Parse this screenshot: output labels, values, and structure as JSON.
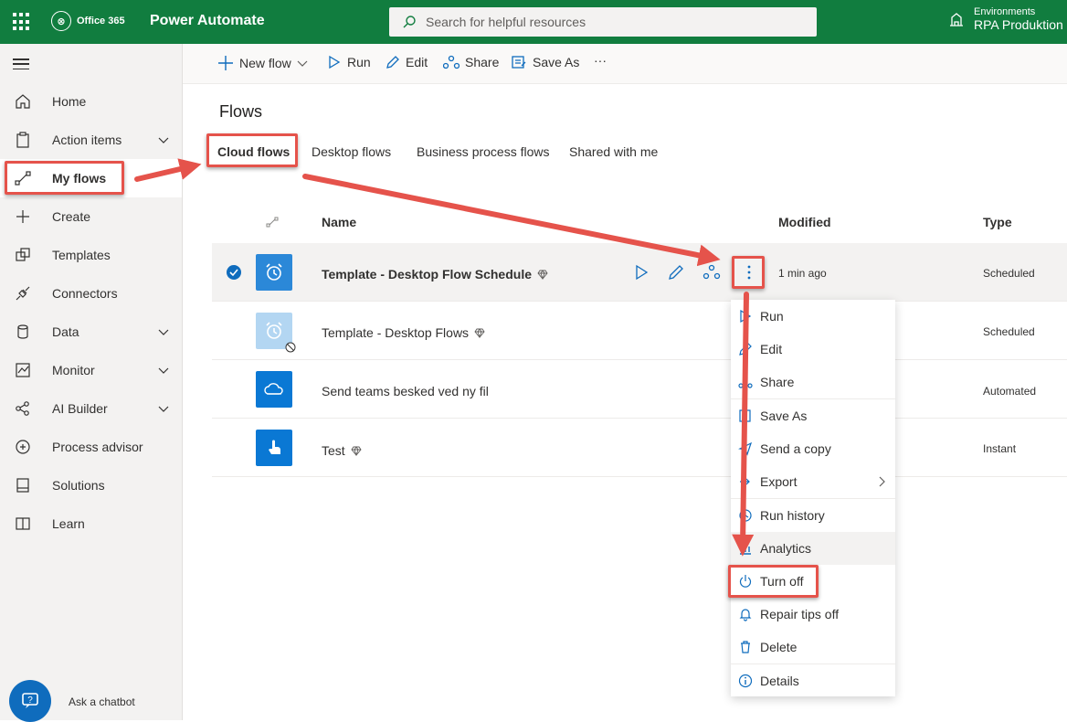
{
  "topbar": {
    "suite": "Office 365",
    "app": "Power Automate",
    "search_placeholder": "Search for helpful resources",
    "env_label": "Environments",
    "env_value": "RPA Produktion"
  },
  "sidebar": {
    "items": [
      {
        "label": "Home",
        "icon": "home-icon"
      },
      {
        "label": "Action items",
        "icon": "clipboard-icon",
        "expandable": true
      },
      {
        "label": "My flows",
        "icon": "flow-icon",
        "active": true
      },
      {
        "label": "Create",
        "icon": "plus-icon"
      },
      {
        "label": "Templates",
        "icon": "templates-icon"
      },
      {
        "label": "Connectors",
        "icon": "plug-icon"
      },
      {
        "label": "Data",
        "icon": "database-icon",
        "expandable": true
      },
      {
        "label": "Monitor",
        "icon": "monitor-icon",
        "expandable": true
      },
      {
        "label": "AI Builder",
        "icon": "ai-icon",
        "expandable": true
      },
      {
        "label": "Process advisor",
        "icon": "process-icon"
      },
      {
        "label": "Solutions",
        "icon": "solutions-icon"
      },
      {
        "label": "Learn",
        "icon": "book-icon"
      }
    ],
    "chatbot": "Ask a chatbot"
  },
  "commands": {
    "new_flow": "New flow",
    "run": "Run",
    "edit": "Edit",
    "share": "Share",
    "save_as": "Save As",
    "more": "···"
  },
  "page": {
    "title": "Flows",
    "tabs": [
      "Cloud flows",
      "Desktop flows",
      "Business process flows",
      "Shared with me"
    ]
  },
  "table": {
    "headers": {
      "name": "Name",
      "modified": "Modified",
      "type": "Type"
    },
    "rows": [
      {
        "name": "Template - Desktop Flow Schedule",
        "modified": "1 min ago",
        "type": "Scheduled",
        "premium": true,
        "icon_color": "#2b88d8",
        "selected": true
      },
      {
        "name": "Template - Desktop Flows",
        "modified": "",
        "type": "Scheduled",
        "premium": true,
        "icon_color": "#b3d6f2",
        "disabled": true
      },
      {
        "name": "Send teams besked ved ny fil",
        "modified": "",
        "type": "Automated",
        "premium": false,
        "icon_color": "#0a78d4"
      },
      {
        "name": "Test",
        "modified": "",
        "type": "Instant",
        "premium": true,
        "icon_color": "#0a78d4"
      }
    ]
  },
  "context_menu": {
    "items": [
      "Run",
      "Edit",
      "Share",
      "Save As",
      "Send a copy",
      "Export",
      "Run history",
      "Analytics",
      "Turn off",
      "Repair tips off",
      "Delete",
      "Details"
    ]
  },
  "colors": {
    "brand": "#117d3f",
    "accent": "#0f6cbd",
    "annotation": "#e5534b"
  }
}
